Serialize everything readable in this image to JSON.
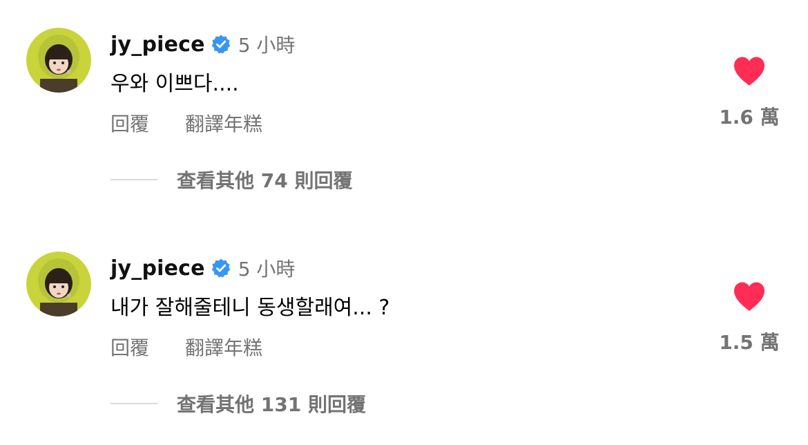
{
  "colors": {
    "heart": "#ff2d55",
    "verified_badge": "#3897f0",
    "secondary_text": "#737373",
    "divider_line": "#d9d9d9"
  },
  "comments": [
    {
      "username": "jy_piece",
      "verified": true,
      "time": "5 小時",
      "text": "우와 이쁘다....",
      "reply_label": "回覆",
      "translate_label": "翻譯年糕",
      "view_replies_label": "查看其他 74 則回覆",
      "like_icon": "heart-filled-icon",
      "like_count": "1.6 萬"
    },
    {
      "username": "jy_piece",
      "verified": true,
      "time": "5 小時",
      "text": "내가 잘해줄테니 동생할래여... ?",
      "reply_label": "回覆",
      "translate_label": "翻譯年糕",
      "view_replies_label": "查看其他 131 則回覆",
      "like_icon": "heart-filled-icon",
      "like_count": "1.5 萬"
    }
  ]
}
